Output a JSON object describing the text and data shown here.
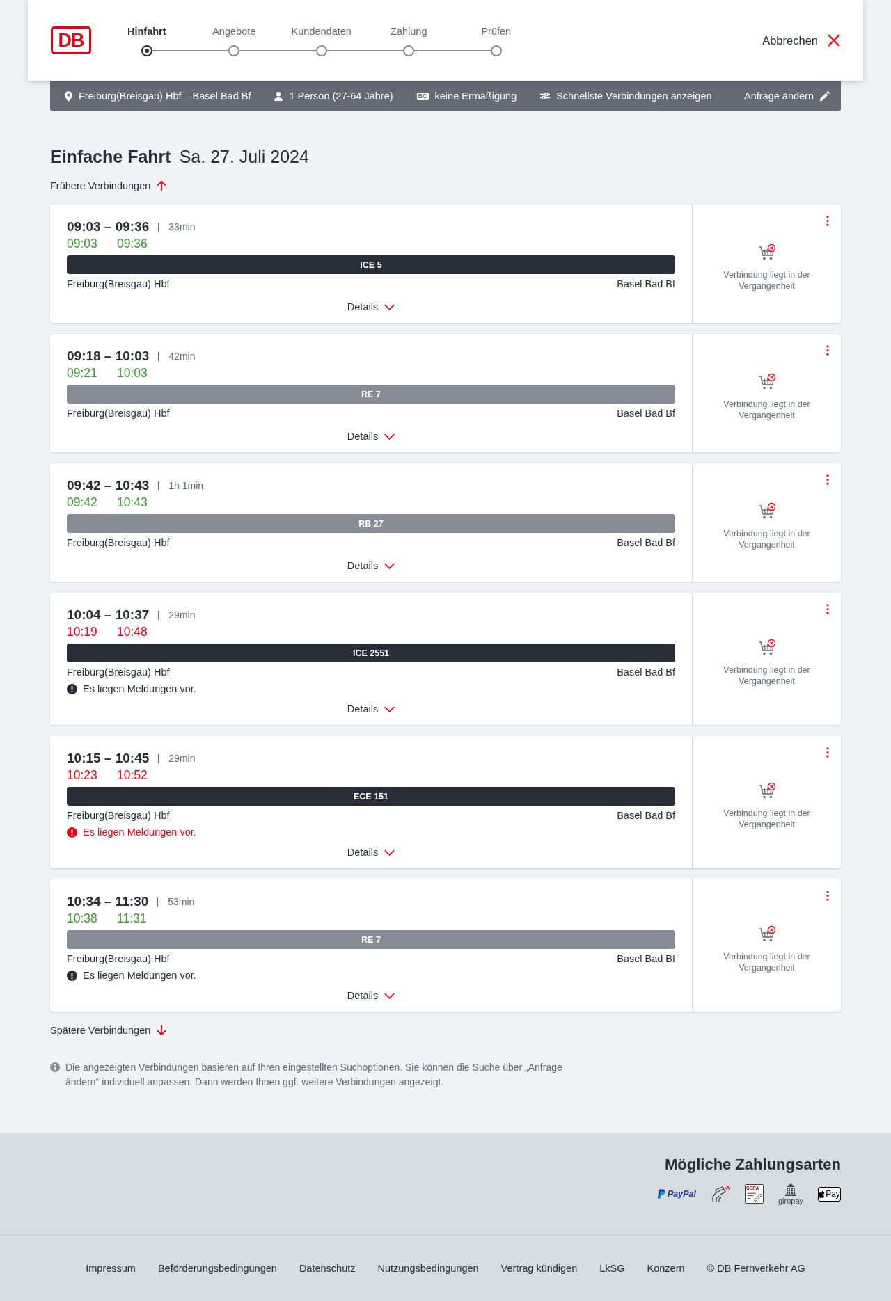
{
  "header": {
    "logo": "DB",
    "steps": [
      {
        "label": "Hinfahrt",
        "selected": true
      },
      {
        "label": "Angebote",
        "selected": false
      },
      {
        "label": "Kundendaten",
        "selected": false
      },
      {
        "label": "Zahlung",
        "selected": false
      },
      {
        "label": "Prüfen",
        "selected": false
      }
    ],
    "cancel": "Abbrechen"
  },
  "summary_bar": {
    "route": "Freiburg(Breisgau) Hbf – Basel Bad Bf",
    "travelers": "1 Person (27-64 Jahre)",
    "discount_badge": "BC",
    "discount": "keine Ermäßigung",
    "filter": "Schnellste Verbindungen anzeigen",
    "edit": "Anfrage ändern"
  },
  "title": "Einfache Fahrt",
  "date": "Sa. 27. Juli 2024",
  "earlier": "Frühere Verbindungen",
  "connections": [
    {
      "times": "09:03 – 09:36",
      "duration": "33min",
      "realtime_departure": "09:03",
      "realtime_arrival": "09:36",
      "delayed": false,
      "train": {
        "name": "ICE 5",
        "kind": "long_distance"
      },
      "from": "Freiburg(Breisgau) Hbf",
      "to": "Basel Bad Bf",
      "details": "Details",
      "status": "Verbindung liegt in der Vergangenheit"
    },
    {
      "times": "09:18 – 10:03",
      "duration": "42min",
      "realtime_departure": "09:21",
      "realtime_arrival": "10:03",
      "delayed": false,
      "train": {
        "name": "RE 7",
        "kind": "regional"
      },
      "from": "Freiburg(Breisgau) Hbf",
      "to": "Basel Bad Bf",
      "details": "Details",
      "status": "Verbindung liegt in der Vergangenheit"
    },
    {
      "times": "09:42 – 10:43",
      "duration": "1h 1min",
      "realtime_departure": "09:42",
      "realtime_arrival": "10:43",
      "delayed": false,
      "train": {
        "name": "RB 27",
        "kind": "regional"
      },
      "from": "Freiburg(Breisgau) Hbf",
      "to": "Basel Bad Bf",
      "details": "Details",
      "status": "Verbindung liegt in der Vergangenheit"
    },
    {
      "times": "10:04 – 10:37",
      "duration": "29min",
      "realtime_departure": "10:19",
      "realtime_arrival": "10:48",
      "delayed": true,
      "train": {
        "name": "ICE 2551",
        "kind": "long_distance"
      },
      "from": "Freiburg(Breisgau) Hbf",
      "to": "Basel Bad Bf",
      "message": {
        "text": "Es liegen Meldungen vor.",
        "critical": false
      },
      "details": "Details",
      "status": "Verbindung liegt in der Vergangenheit"
    },
    {
      "times": "10:15 – 10:45",
      "duration": "29min",
      "realtime_departure": "10:23",
      "realtime_arrival": "10:52",
      "delayed": true,
      "train": {
        "name": "ECE 151",
        "kind": "long_distance"
      },
      "from": "Freiburg(Breisgau) Hbf",
      "to": "Basel Bad Bf",
      "message": {
        "text": "Es liegen Meldungen vor.",
        "critical": true
      },
      "details": "Details",
      "status": "Verbindung liegt in der Vergangenheit"
    },
    {
      "times": "10:34 – 11:30",
      "duration": "53min",
      "realtime_departure": "10:38",
      "realtime_arrival": "11:31",
      "delayed": false,
      "train": {
        "name": "RE 7",
        "kind": "regional"
      },
      "from": "Freiburg(Breisgau) Hbf",
      "to": "Basel Bad Bf",
      "message": {
        "text": "Es liegen Meldungen vor.",
        "critical": false
      },
      "details": "Details",
      "status": "Verbindung liegt in der Vergangenheit"
    }
  ],
  "later": "Spätere Verbindungen",
  "info": "Die angezeigten Verbindungen basieren auf Ihren eingestellten Suchoptionen. Sie können die Suche über „Anfrage ändern“ individuell anpassen. Dann werden Ihnen ggf. weitere Verbindungen angezeigt.",
  "payment": {
    "title": "Mögliche Zahlungsarten",
    "methods": [
      {
        "kind": "paypal",
        "label": "PayPal"
      },
      {
        "kind": "contactless"
      },
      {
        "kind": "sepa",
        "label": "SEPA"
      },
      {
        "kind": "giropay",
        "label": "giropay"
      },
      {
        "kind": "applepay",
        "label": "Pay"
      }
    ]
  },
  "footer_links": [
    "Impressum",
    "Beförderungsbedingungen",
    "Datenschutz",
    "Nutzungsbedingungen",
    "Vertrag kündigen",
    "LkSG",
    "Konzern",
    "© DB Fernverkehr AG"
  ]
}
